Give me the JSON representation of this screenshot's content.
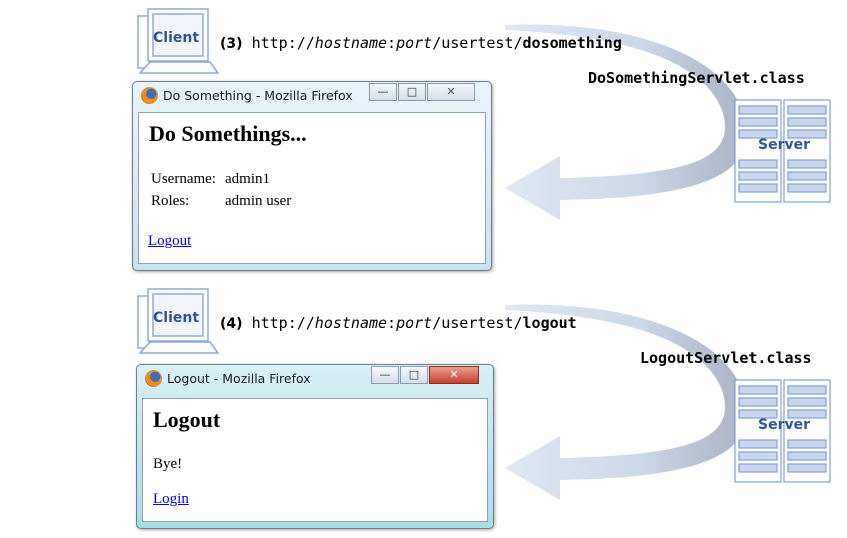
{
  "steps": [
    {
      "client_label": "Client",
      "step_number": "(3)",
      "url_prefix": "http://",
      "url_host": "hostname",
      "url_colon": ":",
      "url_port": "port",
      "url_app": "/usertest/",
      "url_path": "dosomething",
      "servlet": "DoSomethingServlet.class",
      "server_label": "Server",
      "window": {
        "title": "Do Something - Mozilla Firefox",
        "heading": "Do Somethings...",
        "username_label": "Username:",
        "username_value": "admin1",
        "roles_label": "Roles:",
        "roles_value": "admin user",
        "link": "Logout",
        "controls": {
          "minimize": "—",
          "maximize": "□",
          "close": "✕"
        }
      }
    },
    {
      "client_label": "Client",
      "step_number": "(4)",
      "url_prefix": "http://",
      "url_host": "hostname",
      "url_colon": ":",
      "url_port": "port",
      "url_app": "/usertest/",
      "url_path": "logout",
      "servlet": "LogoutServlet.class",
      "server_label": "Server",
      "window": {
        "title": "Logout - Mozilla Firefox",
        "heading": "Logout",
        "message": "Bye!",
        "link": "Login",
        "controls": {
          "minimize": "—",
          "maximize": "□",
          "close": "✕"
        }
      }
    }
  ],
  "colors": {
    "arrow": "#c5d3e8",
    "arrow_dark": "#9aa6bd",
    "client_icon": "#8eaadb",
    "server_icon": "#7f9fd4",
    "label": "#2f5597",
    "link": "#0000ee"
  }
}
